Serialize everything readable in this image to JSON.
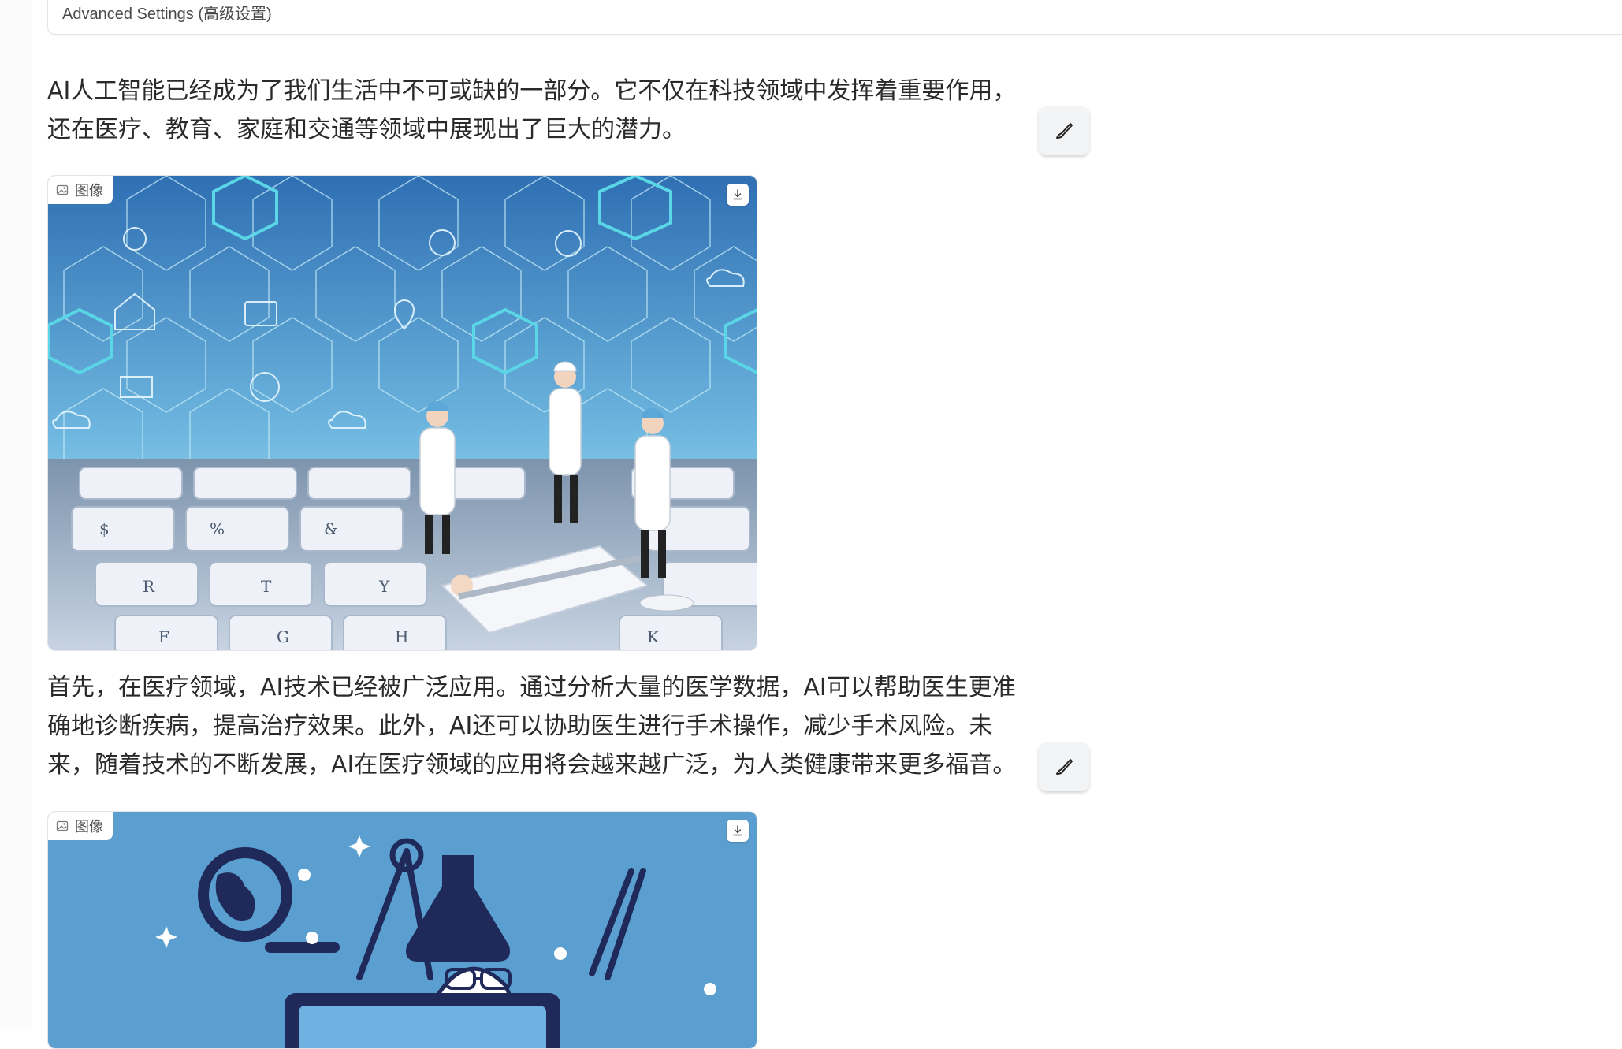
{
  "advanced_settings": {
    "label": "Advanced Settings (高级设置)"
  },
  "blocks": [
    {
      "paragraph": "AI人工智能已经成为了我们生活中不可或缺的一部分。它不仅在科技领域中发挥着重要作用，还在医疗、教育、家庭和交通等领域中展现出了巨大的潜力。",
      "image_label": "图像"
    },
    {
      "paragraph": "首先，在医疗领域，AI技术已经被广泛应用。通过分析大量的医学数据，AI可以帮助医生更准确地诊断疾病，提高治疗效果。此外，AI还可以协助医生进行手术操作，减少手术风险。未来，随着技术的不断发展，AI在医疗领域的应用将会越来越广泛，为人类健康带来更多福音。",
      "image_label": "图像"
    }
  ],
  "icons": {
    "brush": "brush-icon",
    "download": "download-icon",
    "image": "image-icon"
  },
  "colors": {
    "hex_light": "#5ad6e6",
    "hex_bg": "#3b8fc9",
    "keyboard": "#e9edf3",
    "illustration_bg": "#5b9fd0",
    "illustration_ink": "#1f2a5a"
  }
}
